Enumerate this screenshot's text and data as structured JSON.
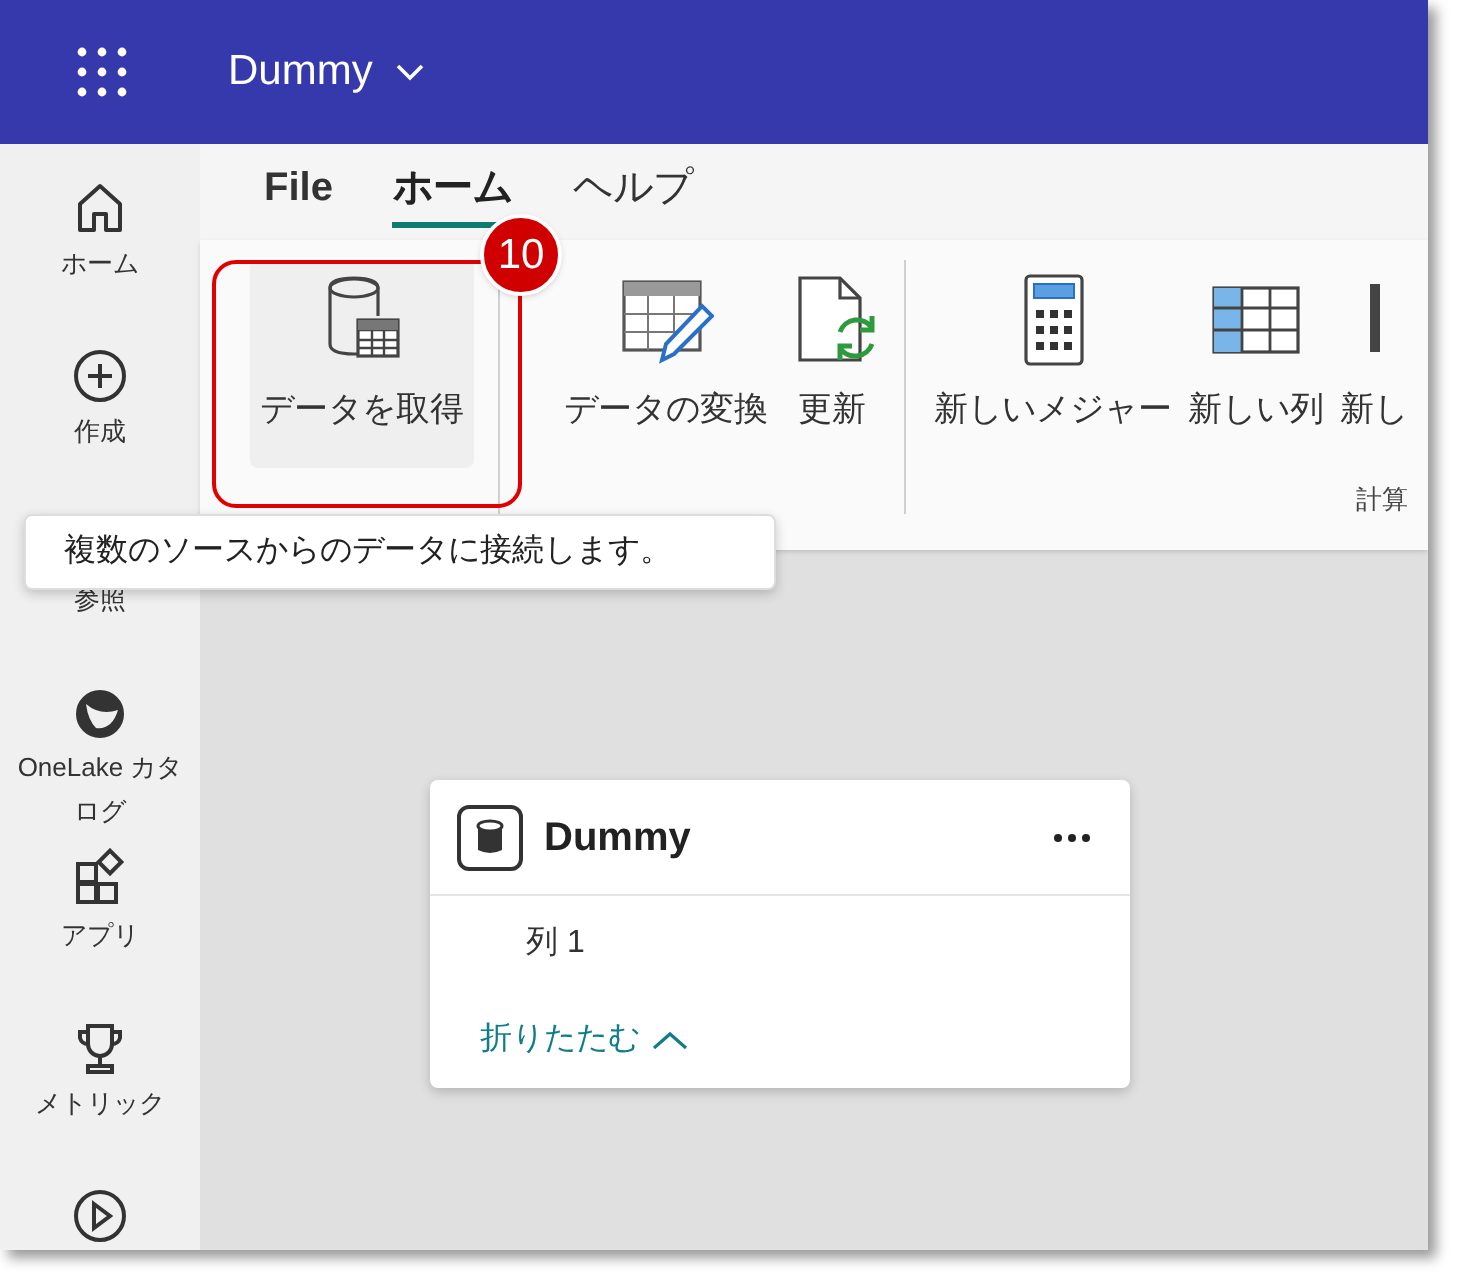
{
  "app": {
    "title": "Dummy"
  },
  "sidebar": {
    "items": [
      {
        "label": "ホーム",
        "kind": "home"
      },
      {
        "label": "作成",
        "kind": "create"
      },
      {
        "label": "参照",
        "kind": "browse"
      },
      {
        "label": "OneLake カタログ",
        "kind": "catalog"
      },
      {
        "label": "アプリ",
        "kind": "apps"
      },
      {
        "label": "メトリック",
        "kind": "metrics"
      },
      {
        "kind": "learn"
      }
    ]
  },
  "tabs": [
    {
      "label": "File",
      "selected": false
    },
    {
      "label": "ホーム",
      "selected": true
    },
    {
      "label": "ヘルプ",
      "selected": false
    }
  ],
  "ribbon": {
    "groups": [
      {
        "buttons": [
          {
            "label": "データを取得",
            "kind": "get-data",
            "hovered": true
          }
        ]
      },
      {
        "buttons": [
          {
            "label": "データの変換",
            "kind": "transform",
            "hovered": false
          },
          {
            "label": "更新",
            "kind": "refresh",
            "hovered": false
          }
        ]
      },
      {
        "label": "計算",
        "buttons": [
          {
            "label": "新しいメジャー",
            "kind": "measure",
            "hovered": false
          },
          {
            "label": "新しい列",
            "kind": "column",
            "hovered": false
          },
          {
            "label": "新し",
            "kind": "partial",
            "hovered": false
          }
        ]
      }
    ]
  },
  "callout": {
    "number": "10"
  },
  "tooltip": {
    "text": "複数のソースからのデータに接続します。"
  },
  "table_card": {
    "title": "Dummy",
    "columns": [
      "列 1"
    ],
    "collapse_link": "折りたたむ"
  }
}
